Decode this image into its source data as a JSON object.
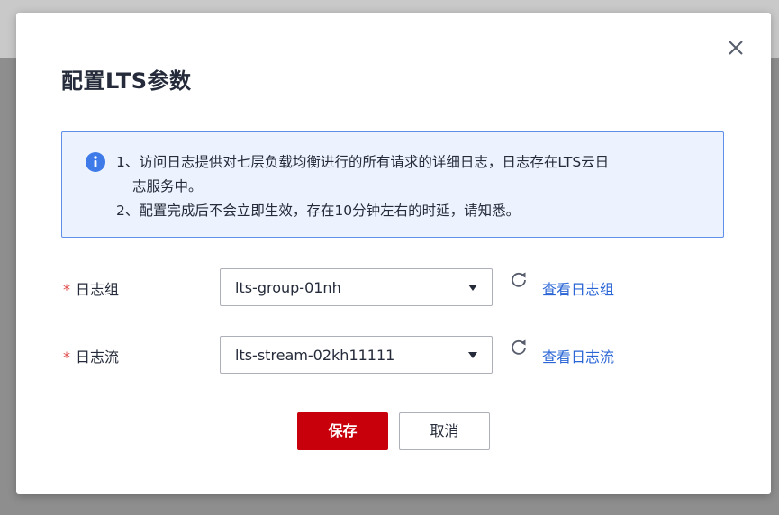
{
  "dialog": {
    "title": "配置LTS参数",
    "close_icon": "close-icon",
    "notice": {
      "icon": "info-icon",
      "lines": [
        "1、访问日志提供对七层负载均衡进行的所有请求的详细日志，日志存在LTS云日",
        "志服务中。",
        "2、配置完成后不会立即生效，存在10分钟左右的时延，请知悉。"
      ]
    },
    "fields": {
      "log_group": {
        "required_mark": "*",
        "label": "日志组",
        "value": "lts-group-01nh",
        "refresh_icon": "refresh-icon",
        "link": "查看日志组"
      },
      "log_stream": {
        "required_mark": "*",
        "label": "日志流",
        "value": "lts-stream-02kh11111",
        "refresh_icon": "refresh-icon",
        "link": "查看日志流"
      }
    },
    "buttons": {
      "save": "保存",
      "cancel": "取消"
    }
  },
  "colors": {
    "primary": "#c7000b",
    "link": "#2a65d6",
    "required": "#e04d4d",
    "info": "#3e7be8",
    "notice_bg": "#edf3fe",
    "notice_border": "#5e8fe9"
  }
}
